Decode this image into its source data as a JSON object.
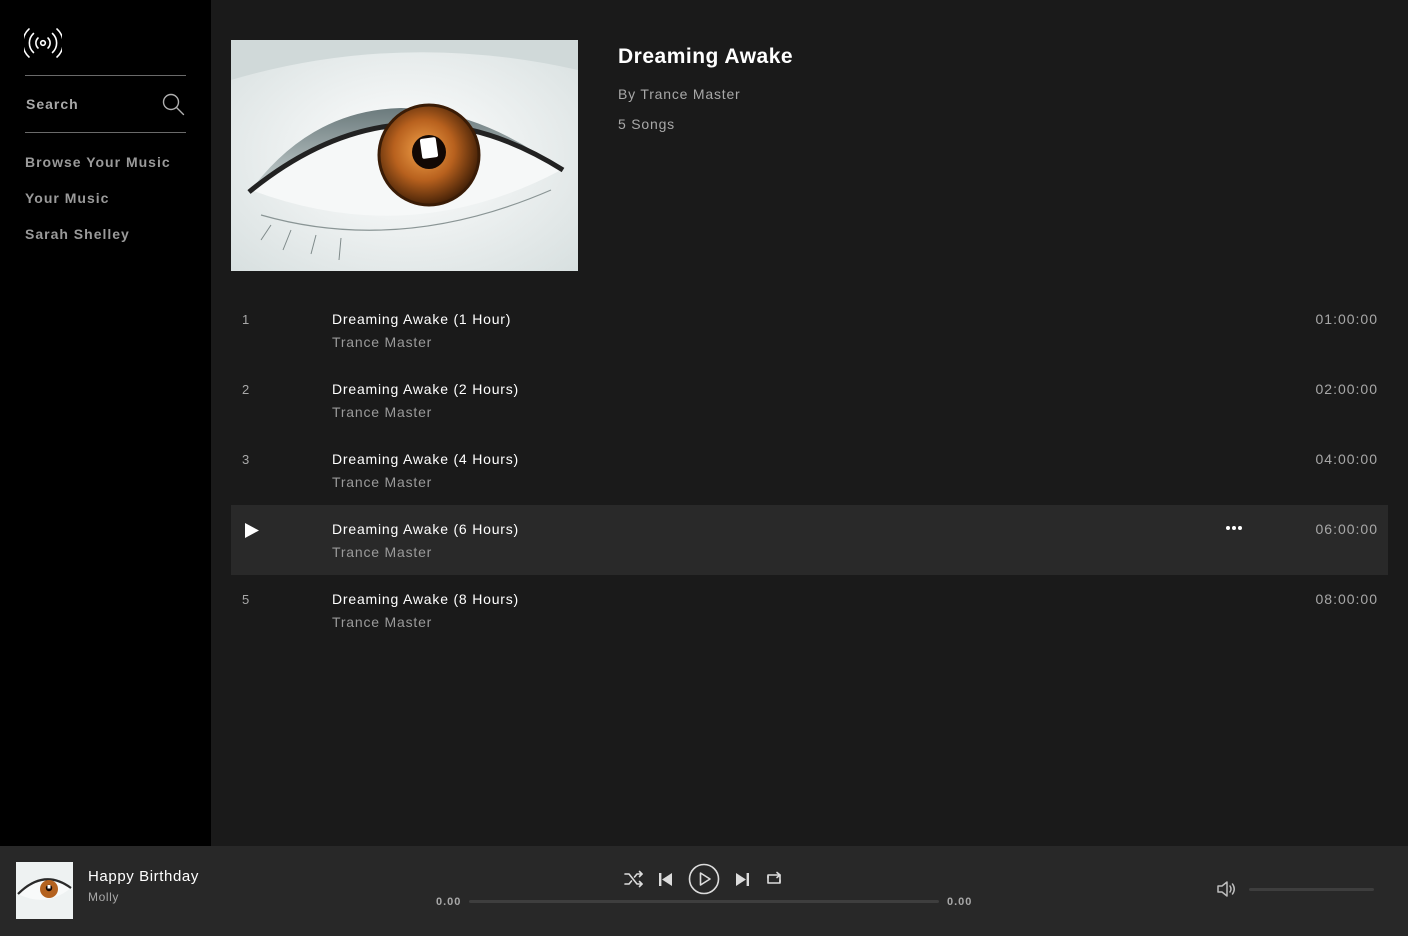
{
  "sidebar": {
    "search_label": "Search",
    "nav": [
      "Browse Your Music",
      "Your Music",
      "Sarah Shelley"
    ]
  },
  "album": {
    "title": "Dreaming Awake",
    "artist_line": "By Trance Master",
    "song_count": "5 Songs"
  },
  "tracks": [
    {
      "num": "1",
      "title": "Dreaming Awake (1 Hour)",
      "artist": "Trance Master",
      "duration": "01:00:00"
    },
    {
      "num": "2",
      "title": "Dreaming Awake (2 Hours)",
      "artist": "Trance Master",
      "duration": "02:00:00"
    },
    {
      "num": "3",
      "title": "Dreaming Awake (4 Hours)",
      "artist": "Trance Master",
      "duration": "04:00:00"
    },
    {
      "num": "4",
      "title": "Dreaming Awake (6 Hours)",
      "artist": "Trance Master",
      "duration": "06:00:00"
    },
    {
      "num": "5",
      "title": "Dreaming Awake (8 Hours)",
      "artist": "Trance Master",
      "duration": "08:00:00"
    }
  ],
  "hovered_track_index": 3,
  "player": {
    "title": "Happy Birthday",
    "artist": "Molly",
    "elapsed": "0.00",
    "total": "0.00",
    "progress": 0,
    "volume": 0
  },
  "icons": {
    "logo": "broadcast-icon",
    "search": "search-icon",
    "play_track": "play-icon",
    "more": "more-icon",
    "shuffle": "shuffle-icon",
    "prev": "previous-icon",
    "play": "play-circle-icon",
    "next": "next-icon",
    "repeat": "repeat-icon",
    "volume": "volume-icon"
  },
  "colors": {
    "sidebar_bg": "#000000",
    "main_bg": "#1a1a1a",
    "player_bg": "#282828",
    "row_hover": "#292929",
    "text_primary": "#ffffff",
    "text_secondary": "#a8a8a8"
  }
}
